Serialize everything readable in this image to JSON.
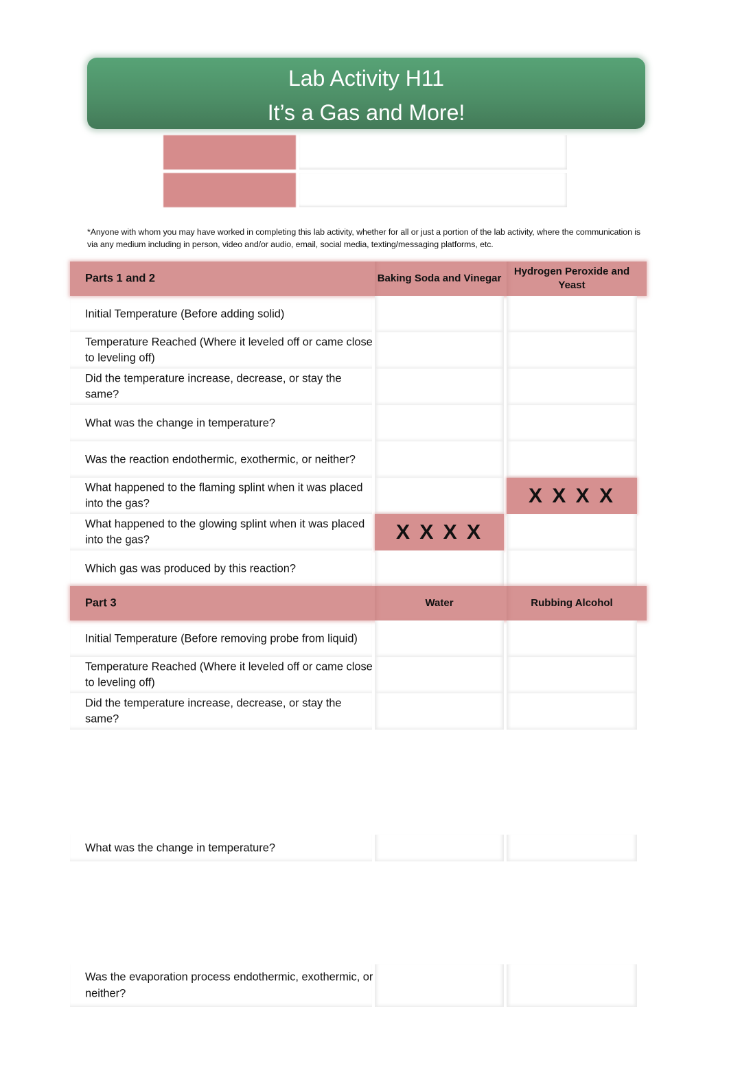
{
  "header": {
    "title_line1": "Lab Activity H11",
    "title_line2": "It’s a Gas and More!",
    "banner_color": "#4e9068"
  },
  "info_fields": [
    {
      "label": "",
      "value": ""
    },
    {
      "label": "",
      "value": ""
    }
  ],
  "note": "*Anyone with whom you may have worked in completing this lab activity, whether for all or just a portion of the lab activity, where the communication is via any medium including in person, video and/or audio, email, social media, texting/messaging platforms, etc.",
  "accent_color": "#d69393",
  "parts_1_2": {
    "heading": "Parts 1 and 2",
    "columns": [
      "Baking Soda and Vinegar",
      "Hydrogen Peroxide and Yeast"
    ],
    "rows": [
      {
        "question": "Initial Temperature (Before adding solid)",
        "values": [
          "",
          ""
        ]
      },
      {
        "question": "Temperature Reached (Where it leveled off or came close to leveling off)",
        "values": [
          "",
          ""
        ]
      },
      {
        "question": "Did the temperature increase, decrease, or stay the same?",
        "values": [
          "",
          ""
        ]
      },
      {
        "question": "What was the change in temperature?",
        "values": [
          "",
          ""
        ]
      },
      {
        "question": "Was the reaction endothermic, exothermic, or neither?",
        "values": [
          "",
          ""
        ]
      },
      {
        "question": "What happened to the flaming splint when it was placed into the gas?",
        "values": [
          "",
          "XXXX"
        ]
      },
      {
        "question": "What happened to the glowing splint when it was placed into the gas?",
        "values": [
          "XXXX",
          ""
        ]
      },
      {
        "question": "Which gas was produced by this reaction?",
        "values": [
          "",
          ""
        ]
      }
    ]
  },
  "part_3": {
    "heading": "Part 3",
    "columns": [
      "Water",
      "Rubbing Alcohol"
    ],
    "rows": [
      {
        "question": "Initial Temperature (Before removing probe from liquid)",
        "values": [
          "",
          ""
        ]
      },
      {
        "question": "Temperature Reached (Where it leveled off or came close to leveling off)",
        "values": [
          "",
          ""
        ]
      },
      {
        "question": "Did the temperature increase, decrease, or stay the same?",
        "values": [
          "",
          ""
        ]
      },
      {
        "question": "What was the change in temperature?",
        "values": [
          "",
          ""
        ]
      },
      {
        "question": "Was the evaporation process endothermic, exothermic, or neither?",
        "values": [
          "",
          ""
        ]
      }
    ]
  }
}
